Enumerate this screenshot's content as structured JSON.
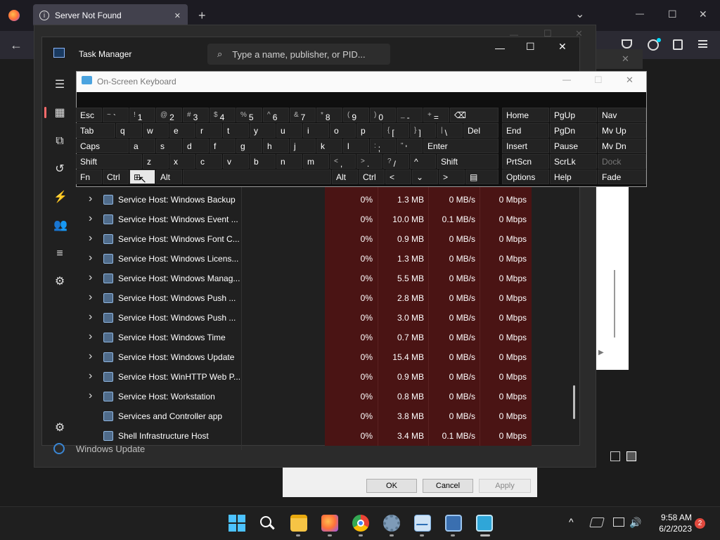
{
  "browser": {
    "tab_title": "Server Not Found",
    "tab_close": "✕",
    "new_tab": "+",
    "menu_chevron": "⌄",
    "back": "←",
    "min": "—",
    "max": "☐",
    "close": "✕",
    "toolbar_icons": [
      "pocket-icon",
      "account-icon",
      "extensions-icon",
      "menu-icon"
    ]
  },
  "background_dialog": {
    "ok": "OK",
    "cancel": "Cancel",
    "apply": "Apply",
    "status_text": "Windows Update"
  },
  "task_manager": {
    "title": "Task Manager",
    "search_placeholder": "Type a name, publisher, or PID...",
    "min": "—",
    "max": "☐",
    "close": "✕",
    "processes": [
      {
        "name": "Service Host: Windows Backup",
        "expand": true,
        "cpu": "0%",
        "memory": "1.3 MB",
        "disk": "0 MB/s",
        "network": "0 Mbps"
      },
      {
        "name": "Service Host: Windows Event ...",
        "expand": true,
        "cpu": "0%",
        "memory": "10.0 MB",
        "disk": "0.1 MB/s",
        "network": "0 Mbps"
      },
      {
        "name": "Service Host: Windows Font C...",
        "expand": true,
        "cpu": "0%",
        "memory": "0.9 MB",
        "disk": "0 MB/s",
        "network": "0 Mbps"
      },
      {
        "name": "Service Host: Windows Licens...",
        "expand": true,
        "cpu": "0%",
        "memory": "1.3 MB",
        "disk": "0 MB/s",
        "network": "0 Mbps"
      },
      {
        "name": "Service Host: Windows Manag...",
        "expand": true,
        "cpu": "0%",
        "memory": "5.5 MB",
        "disk": "0 MB/s",
        "network": "0 Mbps"
      },
      {
        "name": "Service Host: Windows Push ...",
        "expand": true,
        "cpu": "0%",
        "memory": "2.8 MB",
        "disk": "0 MB/s",
        "network": "0 Mbps"
      },
      {
        "name": "Service Host: Windows Push ...",
        "expand": true,
        "cpu": "0%",
        "memory": "3.0 MB",
        "disk": "0 MB/s",
        "network": "0 Mbps"
      },
      {
        "name": "Service Host: Windows Time",
        "expand": true,
        "cpu": "0%",
        "memory": "0.7 MB",
        "disk": "0 MB/s",
        "network": "0 Mbps"
      },
      {
        "name": "Service Host: Windows Update",
        "expand": true,
        "cpu": "0%",
        "memory": "15.4 MB",
        "disk": "0 MB/s",
        "network": "0 Mbps"
      },
      {
        "name": "Service Host: WinHTTP Web P...",
        "expand": true,
        "cpu": "0%",
        "memory": "0.9 MB",
        "disk": "0 MB/s",
        "network": "0 Mbps"
      },
      {
        "name": "Service Host: Workstation",
        "expand": true,
        "cpu": "0%",
        "memory": "0.8 MB",
        "disk": "0 MB/s",
        "network": "0 Mbps"
      },
      {
        "name": "Services and Controller app",
        "expand": false,
        "cpu": "0%",
        "memory": "3.8 MB",
        "disk": "0 MB/s",
        "network": "0 Mbps"
      },
      {
        "name": "Shell Infrastructure Host",
        "expand": false,
        "cpu": "0%",
        "memory": "3.4 MB",
        "disk": "0.1 MB/s",
        "network": "0 Mbps"
      }
    ]
  },
  "osk": {
    "title": "On-Screen Keyboard",
    "min": "—",
    "max": "☐",
    "close": "✕",
    "row1": [
      {
        "main": "Esc"
      },
      {
        "shift": "~",
        "main": "`"
      },
      {
        "shift": "!",
        "main": "1"
      },
      {
        "shift": "@",
        "main": "2"
      },
      {
        "shift": "#",
        "main": "3"
      },
      {
        "shift": "$",
        "main": "4"
      },
      {
        "shift": "%",
        "main": "5"
      },
      {
        "shift": "^",
        "main": "6"
      },
      {
        "shift": "&",
        "main": "7"
      },
      {
        "shift": "*",
        "main": "8"
      },
      {
        "shift": "(",
        "main": "9"
      },
      {
        "shift": ")",
        "main": "0"
      },
      {
        "shift": "_",
        "main": "-"
      },
      {
        "shift": "+",
        "main": "="
      },
      {
        "main": "⌫"
      }
    ],
    "row2": [
      {
        "main": "Tab"
      },
      {
        "main": "q"
      },
      {
        "main": "w"
      },
      {
        "main": "e"
      },
      {
        "main": "r"
      },
      {
        "main": "t"
      },
      {
        "main": "y"
      },
      {
        "main": "u"
      },
      {
        "main": "i"
      },
      {
        "main": "o"
      },
      {
        "main": "p"
      },
      {
        "shift": "{",
        "main": "["
      },
      {
        "shift": "}",
        "main": "]"
      },
      {
        "shift": "|",
        "main": "\\"
      },
      {
        "main": "Del"
      }
    ],
    "row3": [
      {
        "main": "Caps"
      },
      {
        "main": "a"
      },
      {
        "main": "s"
      },
      {
        "main": "d"
      },
      {
        "main": "f"
      },
      {
        "main": "g"
      },
      {
        "main": "h"
      },
      {
        "main": "j"
      },
      {
        "main": "k"
      },
      {
        "main": "l"
      },
      {
        "shift": ":",
        "main": ";"
      },
      {
        "shift": "\"",
        "main": "'"
      },
      {
        "main": "Enter"
      }
    ],
    "row4": [
      {
        "main": "Shift"
      },
      {
        "main": "z"
      },
      {
        "main": "x"
      },
      {
        "main": "c"
      },
      {
        "main": "v"
      },
      {
        "main": "b"
      },
      {
        "main": "n"
      },
      {
        "main": "m"
      },
      {
        "shift": "<",
        "main": ","
      },
      {
        "shift": ">",
        "main": "."
      },
      {
        "shift": "?",
        "main": "/"
      },
      {
        "main": "^"
      },
      {
        "main": "Shift"
      }
    ],
    "row5": [
      {
        "main": "Fn"
      },
      {
        "main": "Ctrl"
      },
      {
        "main": "⊞"
      },
      {
        "main": "Alt"
      },
      {
        "main": ""
      },
      {
        "main": "Alt"
      },
      {
        "main": "Ctrl"
      },
      {
        "main": "<"
      },
      {
        "main": "⌄"
      },
      {
        "main": ">"
      },
      {
        "main": "▤"
      }
    ],
    "nav_col1": [
      "Home",
      "End",
      "Insert",
      "PrtScn",
      "Options"
    ],
    "nav_col2": [
      "PgUp",
      "PgDn",
      "Pause",
      "ScrLk",
      "Help"
    ],
    "nav_col3": [
      "Nav",
      "Mv Up",
      "Mv Dn",
      "Dock",
      "Fade"
    ]
  },
  "taskbar": {
    "time": "9:58 AM",
    "date": "6/2/2023",
    "notification_count": "2",
    "tray_chevron": "^",
    "apps": [
      "windows-start-icon",
      "search-icon",
      "file-explorer-icon",
      "firefox-icon",
      "chrome-icon",
      "settings-icon",
      "task-manager-icon",
      "remote-desktop-icon",
      "on-screen-keyboard-icon"
    ]
  }
}
